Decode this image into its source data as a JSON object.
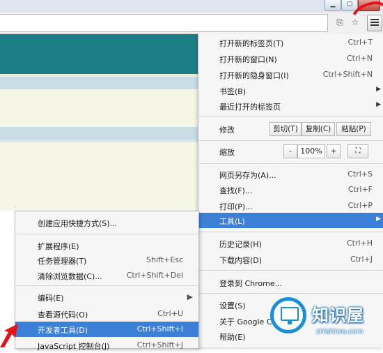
{
  "menu": {
    "new_tab": {
      "label": "打开新的标签页(T)",
      "shortcut": "Ctrl+T"
    },
    "new_window": {
      "label": "打开新的窗口(N)",
      "shortcut": "Ctrl+N"
    },
    "new_incognito": {
      "label": "打开新的隐身窗口(I)",
      "shortcut": "Ctrl+Shift+N"
    },
    "bookmarks": {
      "label": "书签(B)"
    },
    "recent_tabs": {
      "label": "最近打开的标签页"
    },
    "edit": {
      "label": "修改",
      "cut": "剪切(T)",
      "copy": "复制(C)",
      "paste": "粘贴(P)"
    },
    "zoom": {
      "label": "缩放",
      "minus": "-",
      "value": "100%",
      "plus": "+"
    },
    "save_as": {
      "label": "网页另存为(A)...",
      "shortcut": "Ctrl+S"
    },
    "find": {
      "label": "查找(F)...",
      "shortcut": "Ctrl+F"
    },
    "print": {
      "label": "打印(P)...",
      "shortcut": "Ctrl+P"
    },
    "tools": {
      "label": "工具(L)"
    },
    "history": {
      "label": "历史记录(H)",
      "shortcut": "Ctrl+H"
    },
    "downloads": {
      "label": "下载内容(D)",
      "shortcut": "Ctrl+J"
    },
    "signin": {
      "label": "登录到 Chrome..."
    },
    "settings": {
      "label": "设置(S)"
    },
    "about": {
      "label": "关于 Google C"
    },
    "help": {
      "label": "帮助(E)"
    }
  },
  "submenu": {
    "create_shortcut": {
      "label": "创建应用快捷方式(S)..."
    },
    "extensions": {
      "label": "扩展程序(E)"
    },
    "task_manager": {
      "label": "任务管理器(T)",
      "shortcut": "Shift+Esc"
    },
    "clear_data": {
      "label": "清除浏览数据(C)...",
      "shortcut": "Ctrl+Shift+Del"
    },
    "encoding": {
      "label": "编码(E)"
    },
    "view_source": {
      "label": "查看源代码(O)",
      "shortcut": "Ctrl+U"
    },
    "dev_tools": {
      "label": "开发者工具(D)",
      "shortcut": "Ctrl+Shift+I"
    },
    "js_console": {
      "label": "JavaScript 控制台(J)",
      "shortcut": "Ctrl+Shift+J"
    }
  },
  "watermark": {
    "title": "知识屋",
    "site": "zhishiwu.com"
  },
  "colors": {
    "highlight": "#3c7fd6",
    "teal": "#1c7f86",
    "annotation": "#e4141b"
  }
}
